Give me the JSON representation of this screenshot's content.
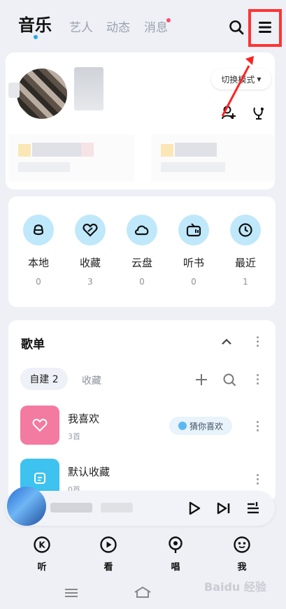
{
  "top_tabs": {
    "music": "音乐",
    "artist": "艺人",
    "feed": "动态",
    "messages": "消息"
  },
  "profile": {
    "switch_mode": "切换模式"
  },
  "quick_access": [
    {
      "label": "本地",
      "count": "0",
      "icon": "local-icon"
    },
    {
      "label": "收藏",
      "count": "3",
      "icon": "heart-icon"
    },
    {
      "label": "云盘",
      "count": "0",
      "icon": "cloud-icon"
    },
    {
      "label": "听书",
      "count": "0",
      "icon": "radio-icon"
    },
    {
      "label": "最近",
      "count": "1",
      "icon": "clock-icon"
    }
  ],
  "playlists_section": {
    "title": "歌单",
    "tab_created": "自建 2",
    "tab_collected": "收藏",
    "items": [
      {
        "name": "我喜欢",
        "count": "3首",
        "badge": "猜你喜欢",
        "color": "#f37aa0"
      },
      {
        "name": "默认收藏",
        "count": "0首",
        "color": "#3ec2f0"
      }
    ]
  },
  "bottom_nav": [
    {
      "label": "听",
      "icon": "listen-icon"
    },
    {
      "label": "看",
      "icon": "watch-icon"
    },
    {
      "label": "唱",
      "icon": "sing-icon"
    },
    {
      "label": "我",
      "icon": "me-icon"
    }
  ],
  "watermark": "Baidu 经验"
}
